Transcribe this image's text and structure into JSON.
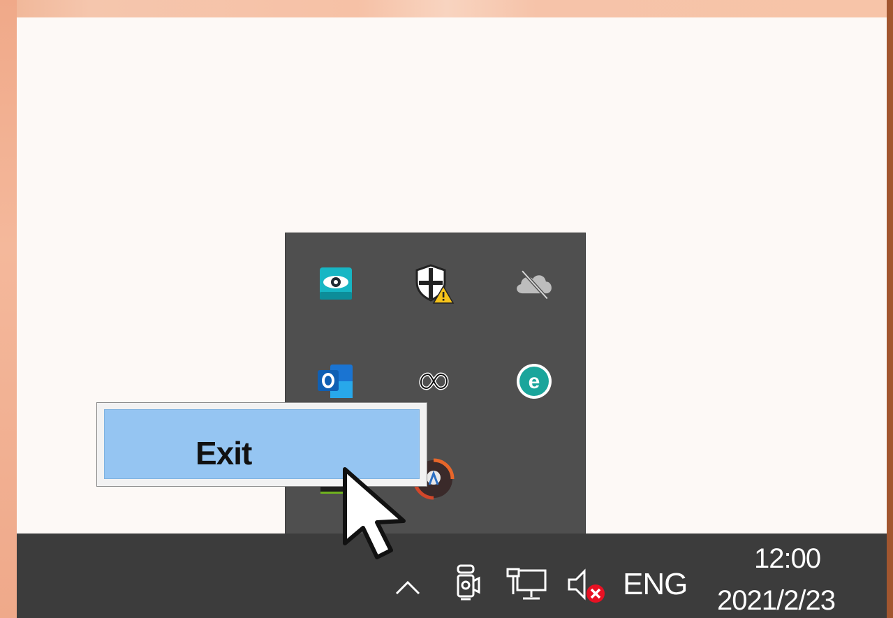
{
  "tray_overflow": {
    "icons": [
      {
        "name": "eye-app-icon"
      },
      {
        "name": "security-shield-warning-icon"
      },
      {
        "name": "onedrive-offline-icon"
      },
      {
        "name": "outlook-icon"
      },
      {
        "name": "creative-cloud-icon"
      },
      {
        "name": "eset-icon"
      },
      {
        "name": "nvidia-icon"
      },
      {
        "name": "app-circle-icon"
      }
    ]
  },
  "context_menu": {
    "items": [
      {
        "label": "Exit"
      }
    ]
  },
  "taskbar": {
    "language": "ENG",
    "time": "12:00",
    "date": "2021/2/23"
  },
  "colors": {
    "taskbar_bg": "#3c3c3c",
    "tray_bg": "#4f4f4f",
    "menu_highlight": "#95c5f2"
  }
}
